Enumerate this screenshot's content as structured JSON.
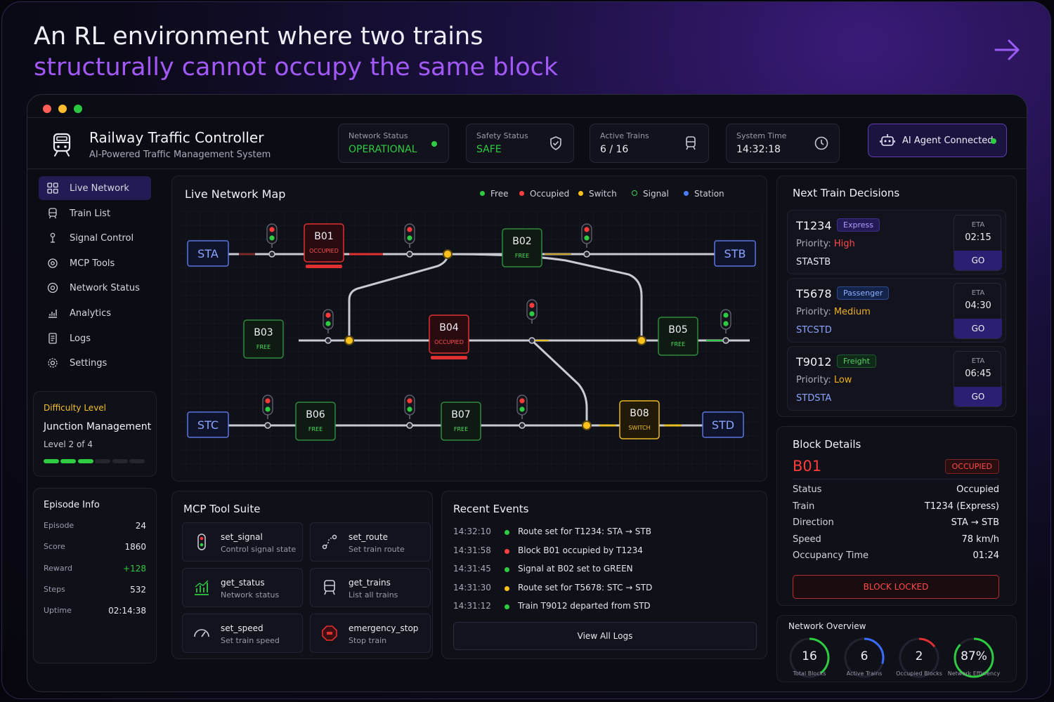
{
  "hero": {
    "line1": "An RL environment where two trains",
    "line2": "structurally cannot occupy the same block"
  },
  "app": {
    "title": "Railway Traffic Controller",
    "subtitle": "AI-Powered Traffic Management System"
  },
  "status": {
    "network": {
      "label": "Network Status",
      "value": "OPERATIONAL"
    },
    "safety": {
      "label": "Safety Status",
      "value": "SAFE"
    },
    "trains": {
      "label": "Active Trains",
      "value": "6 / 16"
    },
    "time": {
      "label": "System Time",
      "value": "14:32:18"
    },
    "agent": "AI Agent Connected"
  },
  "nav": [
    {
      "label": "Live Network",
      "icon": "grid-icon"
    },
    {
      "label": "Train List",
      "icon": "train-icon"
    },
    {
      "label": "Signal Control",
      "icon": "signal-icon"
    },
    {
      "label": "MCP Tools",
      "icon": "tools-icon"
    },
    {
      "label": "Network Status",
      "icon": "network-icon"
    },
    {
      "label": "Analytics",
      "icon": "analytics-icon"
    },
    {
      "label": "Logs",
      "icon": "logs-icon"
    },
    {
      "label": "Settings",
      "icon": "gear-icon"
    }
  ],
  "difficulty": {
    "title": "Difficulty Level",
    "name": "Junction Management",
    "level": "Level 2 of 4",
    "filled": 3,
    "total": 6
  },
  "episode": {
    "title": "Episode Info",
    "rows": [
      {
        "label": "Episode",
        "value": "24"
      },
      {
        "label": "Score",
        "value": "1860"
      },
      {
        "label": "Reward",
        "value": "+128"
      },
      {
        "label": "Steps",
        "value": "532"
      },
      {
        "label": "Uptime",
        "value": "02:14:38"
      }
    ]
  },
  "map": {
    "title": "Live Network Map",
    "legend": [
      {
        "label": "Free",
        "color": "#2ecc40"
      },
      {
        "label": "Occupied",
        "color": "#ff4040"
      },
      {
        "label": "Switch",
        "color": "#ffc21a"
      },
      {
        "label": "Signal",
        "color": "#3ecf5a"
      },
      {
        "label": "Station",
        "color": "#4a7cff"
      }
    ],
    "stations": [
      "STA",
      "STB",
      "STC",
      "STD"
    ],
    "blocks": [
      {
        "id": "B01",
        "state": "OCCUPIED"
      },
      {
        "id": "B02",
        "state": "FREE"
      },
      {
        "id": "B03",
        "state": "FREE"
      },
      {
        "id": "B04",
        "state": "OCCUPIED"
      },
      {
        "id": "B05",
        "state": "FREE"
      },
      {
        "id": "B06",
        "state": "FREE"
      },
      {
        "id": "B07",
        "state": "FREE"
      },
      {
        "id": "B08",
        "state": "SWITCH"
      }
    ]
  },
  "tools": {
    "title": "MCP Tool Suite",
    "items": [
      {
        "name": "set_signal",
        "desc": "Control signal state",
        "icon": "traffic-light-icon"
      },
      {
        "name": "set_route",
        "desc": "Set train route",
        "icon": "route-icon"
      },
      {
        "name": "get_status",
        "desc": "Network status",
        "icon": "chart-icon"
      },
      {
        "name": "get_trains",
        "desc": "List all trains",
        "icon": "train-icon"
      },
      {
        "name": "set_speed",
        "desc": "Set train speed",
        "icon": "speedometer-icon"
      },
      {
        "name": "emergency_stop",
        "desc": "Stop train",
        "icon": "stop-icon"
      }
    ]
  },
  "events": {
    "title": "Recent Events",
    "view_all": "View All Logs",
    "items": [
      {
        "time": "14:32:10",
        "msg": "Route set for T1234: STA → STB",
        "color": "#2ecc40"
      },
      {
        "time": "14:31:58",
        "msg": "Block B01 occupied by T1234",
        "color": "#ff4040"
      },
      {
        "time": "14:31:45",
        "msg": "Signal at B02 set to GREEN",
        "color": "#2ecc40"
      },
      {
        "time": "14:31:30",
        "msg": "Route set for T5678: STC → STD",
        "color": "#ffc21a"
      },
      {
        "time": "14:31:12",
        "msg": "Train T9012 departed from STD",
        "color": "#2ecc40"
      }
    ]
  },
  "decisions": {
    "title": "Next Train Decisions",
    "trains": [
      {
        "id": "T1234",
        "type": "Express",
        "prio_label": "Priority: ",
        "prio": "High",
        "from": "STA",
        "to": "STB",
        "eta_label": "ETA",
        "eta": "02:15",
        "action": "GO"
      },
      {
        "id": "T5678",
        "type": "Passenger",
        "prio_label": "Priority: ",
        "prio": "Medium",
        "from": "STC",
        "to": "STD",
        "eta_label": "ETA",
        "eta": "04:30",
        "action": "GO"
      },
      {
        "id": "T9012",
        "type": "Freight",
        "prio_label": "Priority: ",
        "prio": "Low",
        "from": "STD",
        "to": "STA",
        "eta_label": "ETA",
        "eta": "06:45",
        "action": "GO"
      }
    ]
  },
  "block": {
    "title": "Block Details",
    "id": "B01",
    "state": "OCCUPIED",
    "locked": "BLOCK LOCKED",
    "rows": [
      {
        "label": "Status",
        "value": "Occupied"
      },
      {
        "label": "Train",
        "value": "T1234 (Express)"
      },
      {
        "label": "Direction",
        "value": "STA → STB"
      },
      {
        "label": "Speed",
        "value": "78 km/h"
      },
      {
        "label": "Occupancy Time",
        "value": "01:24"
      }
    ]
  },
  "overview": {
    "title": "Network Overview",
    "items": [
      {
        "value": "16",
        "label": "Total Blocks",
        "color": "#2ecc40",
        "fraction": 0.4
      },
      {
        "value": "6",
        "label": "Active Trains",
        "color": "#3a6cff",
        "fraction": 0.3
      },
      {
        "value": "2",
        "label": "Occupied Blocks",
        "color": "#e03030",
        "fraction": 0.15
      },
      {
        "value": "87%",
        "label": "Network Efficiency",
        "color": "#2ecc40",
        "fraction": 0.87
      }
    ]
  }
}
